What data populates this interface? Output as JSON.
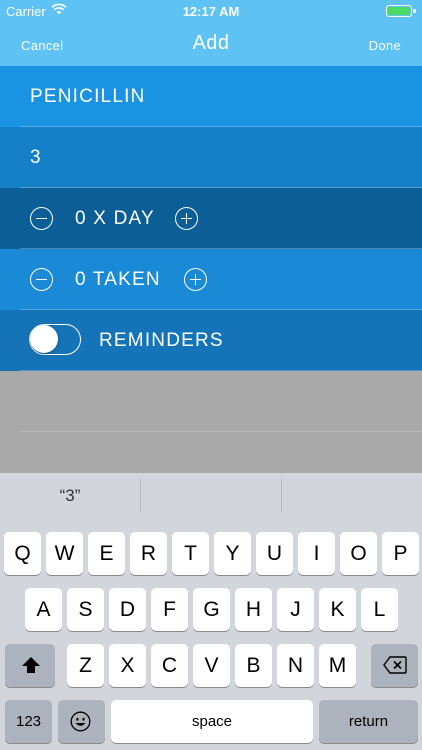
{
  "status_bar": {
    "carrier": "Carrier",
    "time": "12:17 AM",
    "battery_color": "#4cd964"
  },
  "nav": {
    "cancel": "Cancel",
    "title": "Add",
    "done": "Done"
  },
  "form": {
    "name": "PENICILLIN",
    "dose": "3",
    "per_day": "0 X DAY",
    "taken": "0 TAKEN",
    "reminders_label": "REMINDERS",
    "reminders_on": false
  },
  "keyboard": {
    "suggestion": "“3”",
    "row1": [
      "Q",
      "W",
      "E",
      "R",
      "T",
      "Y",
      "U",
      "I",
      "O",
      "P"
    ],
    "row2": [
      "A",
      "S",
      "D",
      "F",
      "G",
      "H",
      "J",
      "K",
      "L"
    ],
    "row3": [
      "Z",
      "X",
      "C",
      "V",
      "B",
      "N",
      "M"
    ],
    "numbers": "123",
    "space": "space",
    "return": "return"
  },
  "colors": {
    "header": "#5ec3f4",
    "name_row": "#1a93e3",
    "dose_row": "#1580c8",
    "day_row": "#0b5e96",
    "taken_row": "#1a8ad6",
    "reminders_row": "#1573b8"
  }
}
